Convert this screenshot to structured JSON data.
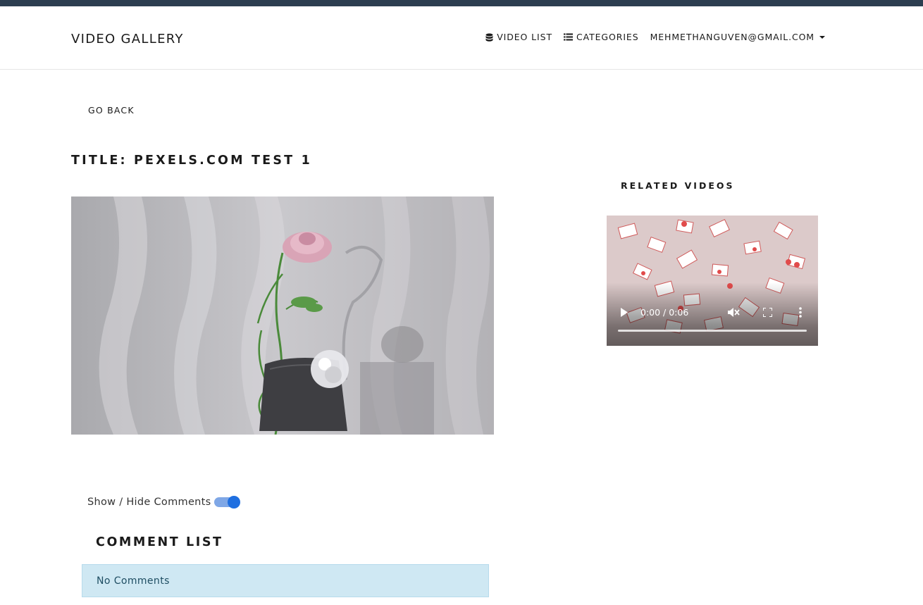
{
  "navbar": {
    "brand": "VIDEO GALLERY",
    "links": [
      {
        "icon": "database-icon",
        "label": "VIDEO LIST"
      },
      {
        "icon": "list-icon",
        "label": "CATEGORIES"
      },
      {
        "label": "MEHMETHANGUVEN@GMAIL.COM",
        "dropdown": true
      }
    ]
  },
  "page": {
    "go_back": "GO BACK",
    "title": "TITLE: PEXELS.COM TEST 1"
  },
  "related": {
    "heading": "RELATED VIDEOS",
    "player": {
      "time": "0:00 / 0:06",
      "icons": [
        "play-icon",
        "mute-icon",
        "fullscreen-icon",
        "more-options-icon"
      ]
    }
  },
  "comments": {
    "toggle_label": "Show / Hide Comments",
    "toggle_on": true,
    "heading": "COMMENT LIST",
    "empty_text": "No Comments"
  },
  "colors": {
    "topbar": "#2c3e50",
    "toggle_accent": "#1f6fe0",
    "alert_bg": "#cfe8f3"
  }
}
